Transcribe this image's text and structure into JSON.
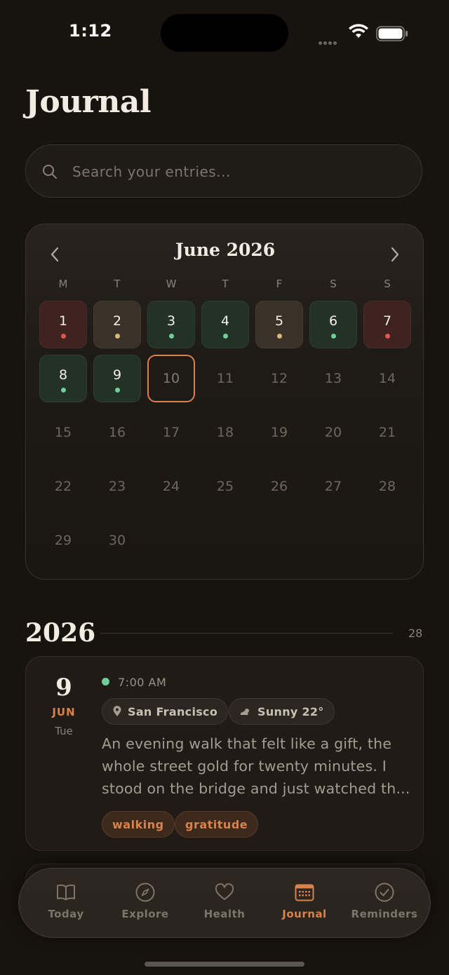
{
  "status": {
    "time": "1:12"
  },
  "header": {
    "title": "Journal"
  },
  "search": {
    "placeholder": "Search your entries..."
  },
  "calendar": {
    "month_label": "June 2026",
    "weekdays": [
      "M",
      "T",
      "W",
      "T",
      "F",
      "S",
      "S"
    ],
    "days": [
      {
        "day": "1",
        "mood": "red"
      },
      {
        "day": "2",
        "mood": "tan"
      },
      {
        "day": "3",
        "mood": "green"
      },
      {
        "day": "4",
        "mood": "green"
      },
      {
        "day": "5",
        "mood": "tan"
      },
      {
        "day": "6",
        "mood": "green"
      },
      {
        "day": "7",
        "mood": "red"
      },
      {
        "day": "8",
        "mood": "green"
      },
      {
        "day": "9",
        "mood": "green"
      },
      {
        "day": "10",
        "mood": "today"
      },
      {
        "day": "11"
      },
      {
        "day": "12"
      },
      {
        "day": "13"
      },
      {
        "day": "14"
      },
      {
        "day": "15"
      },
      {
        "day": "16"
      },
      {
        "day": "17"
      },
      {
        "day": "18"
      },
      {
        "day": "19"
      },
      {
        "day": "20"
      },
      {
        "day": "21"
      },
      {
        "day": "22"
      },
      {
        "day": "23"
      },
      {
        "day": "24"
      },
      {
        "day": "25"
      },
      {
        "day": "26"
      },
      {
        "day": "27"
      },
      {
        "day": "28"
      },
      {
        "day": "29"
      },
      {
        "day": "30"
      }
    ],
    "mood_colors": {
      "green": "#6fcf97",
      "tan": "#d6b87a",
      "red": "#e0574f"
    }
  },
  "section": {
    "year": "2026",
    "count": "28"
  },
  "entry": {
    "day": "9",
    "month": "JUN",
    "weekday": "Tue",
    "time": "7:00 AM",
    "location": "San Francisco",
    "weather": "Sunny 22°",
    "body_lines": [
      "An evening walk that felt like a gift, the",
      "whole street gold for twenty minutes. I",
      "stood on the bridge and just watched th..."
    ],
    "tags": [
      "walking",
      "gratitude"
    ]
  },
  "tabs": [
    {
      "label": "Today",
      "icon": "book-icon"
    },
    {
      "label": "Explore",
      "icon": "compass-icon"
    },
    {
      "label": "Health",
      "icon": "heart-icon"
    },
    {
      "label": "Journal",
      "icon": "calendar-icon",
      "active": true
    },
    {
      "label": "Reminders",
      "icon": "check-circle-icon"
    }
  ],
  "colors": {
    "accent": "#d9824a",
    "background": "#17130f"
  }
}
